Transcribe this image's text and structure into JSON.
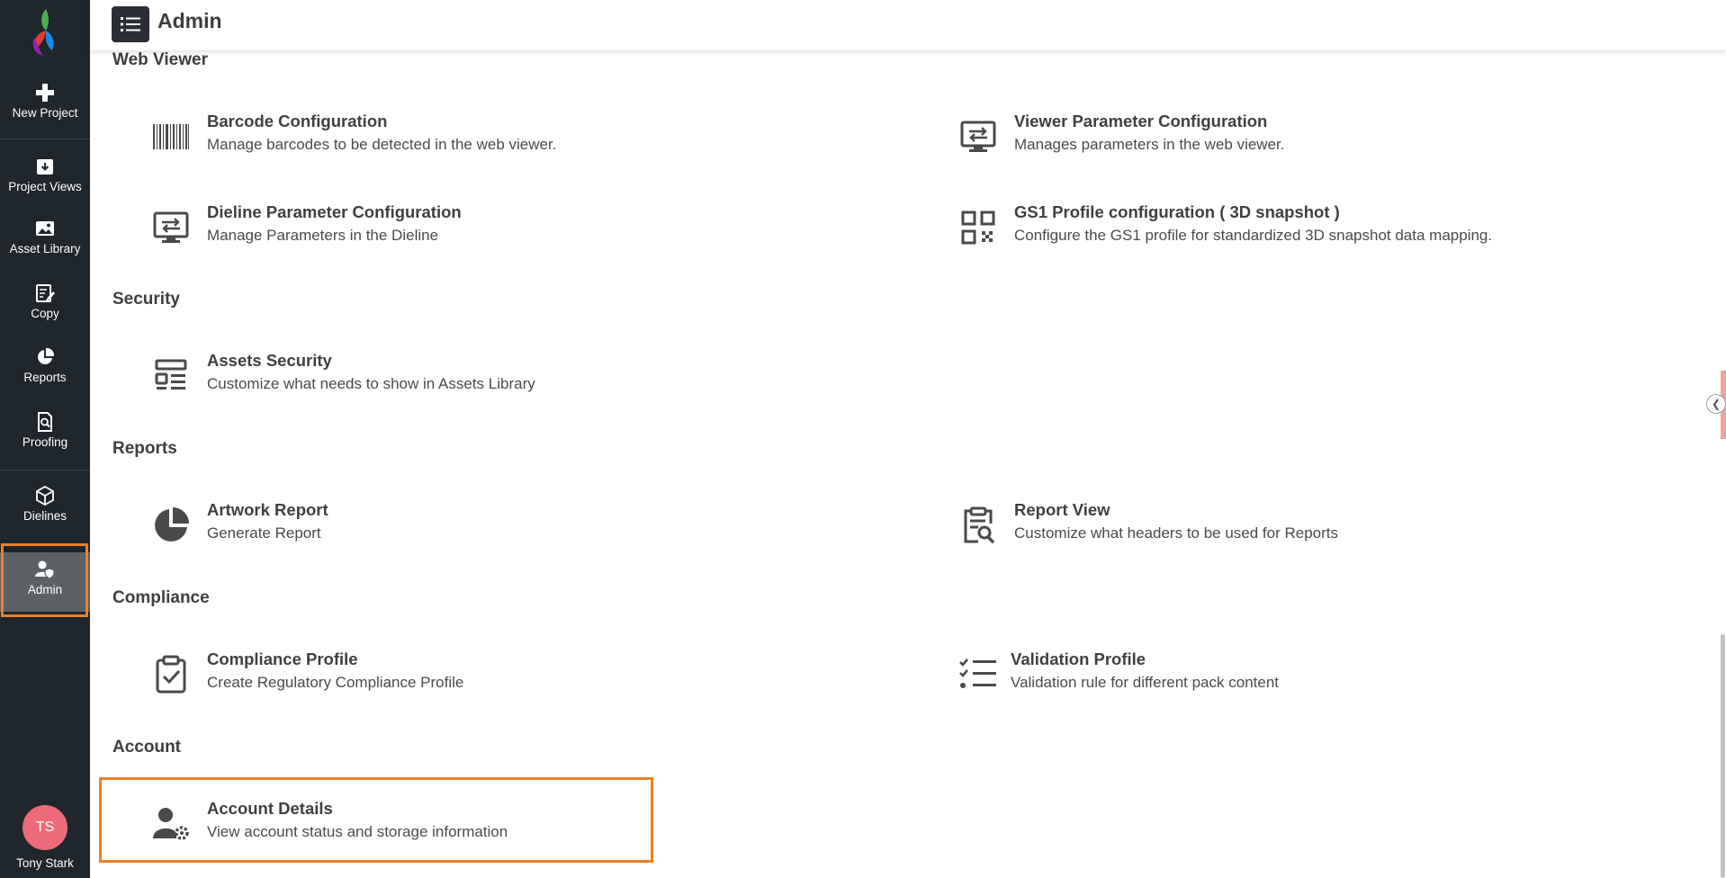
{
  "sidebar": {
    "new_project": "New Project",
    "items": [
      {
        "label": "Project Views",
        "icon": "download-box-icon"
      },
      {
        "label": "Asset Library",
        "icon": "image-icon"
      },
      {
        "label": "Copy",
        "icon": "edit-document-icon"
      },
      {
        "label": "Reports",
        "icon": "pie-chart-icon"
      },
      {
        "label": "Proofing",
        "icon": "search-document-icon"
      },
      {
        "label": "Dielines",
        "icon": "cube-icon"
      },
      {
        "label": "Admin",
        "icon": "user-shield-icon",
        "active": true
      }
    ],
    "user": {
      "initials": "TS",
      "name": "Tony Stark",
      "avatar_color": "#ee6b79"
    }
  },
  "header": {
    "title": "Admin"
  },
  "sections": [
    {
      "title": "Web Viewer",
      "cards": [
        {
          "title": "Barcode Configuration",
          "description": "Manage barcodes to be detected in the web viewer.",
          "icon": "barcode-icon"
        },
        {
          "title": "Viewer Parameter Configuration",
          "description": "Manages parameters in the web viewer.",
          "icon": "monitor-settings-icon"
        },
        {
          "title": "Dieline Parameter Configuration",
          "description": "Manage Parameters in the Dieline",
          "icon": "monitor-settings-icon"
        },
        {
          "title": "GS1 Profile configuration ( 3D snapshot )",
          "description": "Configure the GS1 profile for standardized 3D snapshot data mapping.",
          "icon": "qr-code-icon"
        }
      ]
    },
    {
      "title": "Security",
      "cards": [
        {
          "title": "Assets Security",
          "description": "Customize what needs to show in Assets Library",
          "icon": "layout-list-icon"
        }
      ]
    },
    {
      "title": "Reports",
      "cards": [
        {
          "title": "Artwork Report",
          "description": "Generate Report",
          "icon": "pie-chart-icon"
        },
        {
          "title": "Report View",
          "description": "Customize what headers to be used for Reports",
          "icon": "clipboard-search-icon"
        }
      ]
    },
    {
      "title": "Compliance",
      "cards": [
        {
          "title": "Compliance Profile",
          "description": "Create Regulatory Compliance Profile",
          "icon": "clipboard-check-icon"
        },
        {
          "title": "Validation Profile",
          "description": "Validation rule for different pack content",
          "icon": "checklist-icon"
        }
      ]
    },
    {
      "title": "Account",
      "cards": [
        {
          "title": "Account Details",
          "description": "View account status and storage information",
          "icon": "user-gear-icon"
        }
      ]
    }
  ],
  "colors": {
    "sidebar_bg": "#1f262c",
    "highlight": "#f07f25",
    "accent_tab": "#f2a49c"
  }
}
